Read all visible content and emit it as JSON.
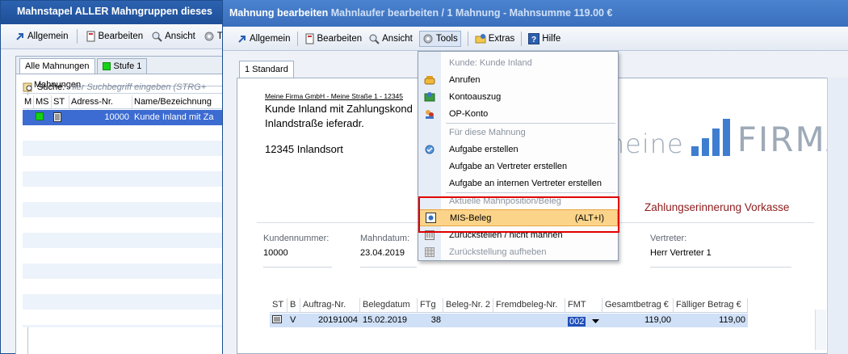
{
  "back_window": {
    "title": "Mahnstapel ALLER Mahngruppen dieses",
    "toolbar": {
      "allgemein": "Allgemein",
      "bearbeiten": "Bearbeiten",
      "ansicht": "Ansicht",
      "tools": "T"
    },
    "tabs": {
      "all": "Alle Mahnungen",
      "stufe": "Stufe 1"
    },
    "group_label": "Mahnungen",
    "search_label": "Suche:",
    "search_placeholder": "Hier Suchbegriff eingeben (STRG+",
    "columns": [
      "M",
      "MS",
      "ST",
      "Adress-Nr.",
      "Name/Bezeichnung"
    ],
    "row": {
      "adress_nr": "10000",
      "name": "Kunde Inland mit Za"
    }
  },
  "front_window": {
    "title": "Mahnung bearbeiten",
    "title_behind": "Mahnlaufer bearbeiten / 1 Mahnung - Mahnsumme 119.00 €",
    "toolbar": {
      "allgemein": "Allgemein",
      "bearbeiten": "Bearbeiten",
      "ansicht": "Ansicht",
      "tools": "Tools",
      "extras": "Extras",
      "hilfe": "Hilfe"
    },
    "tab": "1 Standard"
  },
  "document": {
    "sender_line": "Meine Firma GmbH - Meine Straße 1 - 12345",
    "recipient": [
      "Kunde Inland mit Zahlungskond",
      "Inlandstraße ieferadr.",
      "12345 Inlandsort"
    ],
    "logo_meine": "meine",
    "logo_firma": "FIRMA",
    "heading": "Zahlungserinnerung Vorkasse",
    "fields": {
      "kundennummer_label": "Kundennummer:",
      "kundennummer": "10000",
      "mahndatum_label": "Mahndatum:",
      "mahndatum": "23.04.2019",
      "vertreter_label": "Vertreter:",
      "vertreter": "Herr Vertreter 1"
    },
    "grid_columns": [
      "ST",
      "B",
      "Auftrag-Nr.",
      "Belegdatum",
      "FTg",
      "Beleg-Nr. 2",
      "Fremdbeleg-Nr.",
      "FMT",
      "Gesamtbetrag €",
      "Fälliger Betrag €"
    ],
    "grid_row": {
      "b": "V",
      "auftrag": "20191004",
      "belegdatum": "15.02.2019",
      "ftg": "38",
      "fmt": "002",
      "gesamt": "119,00",
      "faellig": "119,00"
    }
  },
  "menu": {
    "section_kunde": "Kunde: Kunde Inland",
    "anrufen": "Anrufen",
    "kontoauszug": "Kontoauszug",
    "op_konto": "OP-Konto",
    "section_mahnung": "Für diese Mahnung",
    "aufgabe": "Aufgabe erstellen",
    "aufgabe_vertreter": "Aufgabe an Vertreter erstellen",
    "aufgabe_intern": "Aufgabe an internen Vertreter erstellen",
    "section_beleg": "Aktuelle Mahnposition/Beleg",
    "mis_beleg": "MIS-Beleg",
    "mis_shortcut": "(ALT+I)",
    "zurueckstellen": "Zurückstellen / nicht mahnen",
    "zurueckstellung_aufheben": "Zurückstellung aufheben"
  }
}
